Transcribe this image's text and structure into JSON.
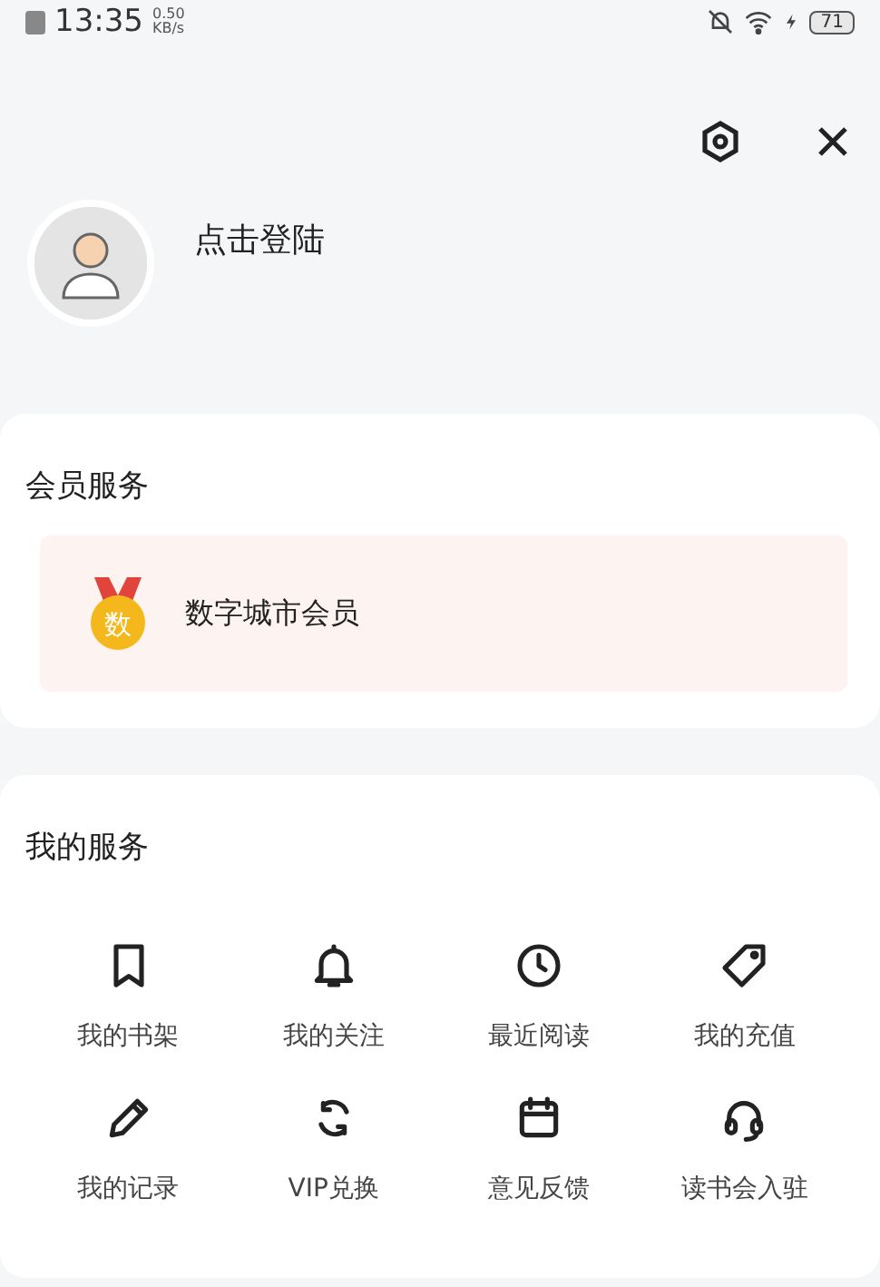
{
  "status_bar": {
    "time": "13:35",
    "speed": "0.50",
    "speed_unit": "KB/s",
    "battery": "71"
  },
  "profile": {
    "login": "点击登陆"
  },
  "membership": {
    "title": "会员服务",
    "item": {
      "badge": "数",
      "label": "数字城市会员"
    }
  },
  "services": {
    "title": "我的服务",
    "items": [
      {
        "label": "我的书架"
      },
      {
        "label": "我的关注"
      },
      {
        "label": "最近阅读"
      },
      {
        "label": "我的充值"
      },
      {
        "label": "我的记录"
      },
      {
        "label": "VIP兑换"
      },
      {
        "label": "意见反馈"
      },
      {
        "label": "读书会入驻"
      }
    ]
  }
}
